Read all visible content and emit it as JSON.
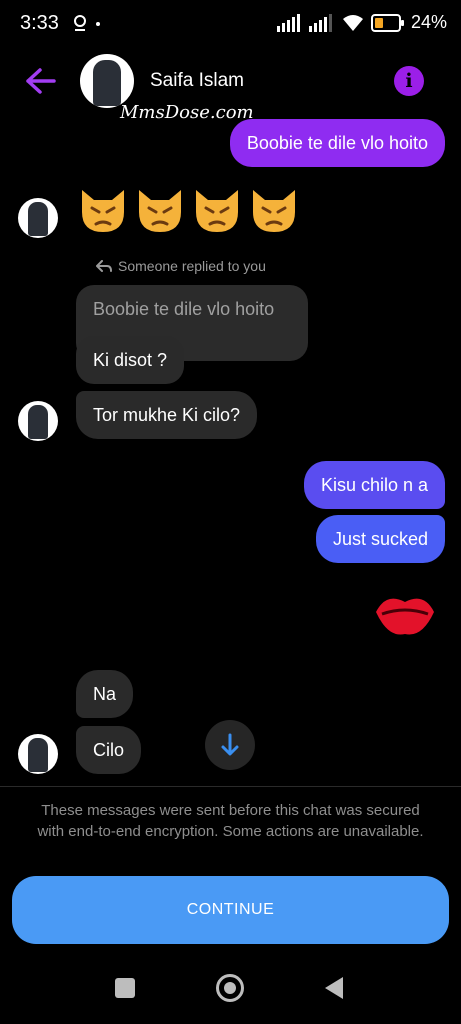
{
  "status_bar": {
    "time": "3:33",
    "battery": "24%",
    "icons": [
      "location-icon",
      "signal-icon",
      "signal-icon",
      "wifi-icon",
      "battery-icon"
    ]
  },
  "header": {
    "contact_name": "Saifa Islam",
    "watermark": "MmsDose.com",
    "icons": [
      "back-arrow-icon",
      "info-icon"
    ],
    "accent_color": "#9b1fe8"
  },
  "messages": {
    "m1_out": "Boobie te dile vlo hoito",
    "m2_in_emoji": [
      "😾",
      "😾",
      "😾",
      "😾"
    ],
    "reply_note": "Someone replied to you",
    "quoted_text": "Boobie te dile vlo hoito",
    "m3_in": "Ki disot ?",
    "m4_in": "Tor mukhe Ki cilo?",
    "m5_out": "Kisu chilo n a",
    "m6_out": "Just sucked",
    "m7_out_emoji": "💋",
    "m8_in": "Na",
    "m9_in": "Cilo"
  },
  "footer": {
    "notice": "These messages were sent before this chat was secured with end-to-end encryption. Some actions are unavailable.",
    "continue_label": "CONTINUE",
    "button_color": "#4a9af5"
  },
  "navbar": {
    "icons": [
      "recents-square-icon",
      "home-circle-icon",
      "back-triangle-icon"
    ]
  }
}
